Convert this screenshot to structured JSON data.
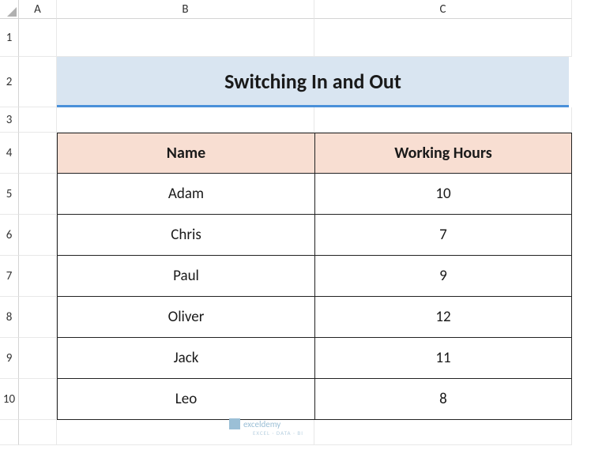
{
  "columns": [
    "A",
    "B",
    "C"
  ],
  "rows": [
    "1",
    "2",
    "3",
    "4",
    "5",
    "6",
    "7",
    "8",
    "9",
    "10"
  ],
  "title": "Switching In and Out",
  "table": {
    "headers": {
      "name": "Name",
      "hours": "Working Hours"
    },
    "rows": [
      {
        "name": "Adam",
        "hours": "10"
      },
      {
        "name": "Chris",
        "hours": "7"
      },
      {
        "name": "Paul",
        "hours": "9"
      },
      {
        "name": "Oliver",
        "hours": "12"
      },
      {
        "name": "Jack",
        "hours": "11"
      },
      {
        "name": "Leo",
        "hours": "8"
      }
    ]
  },
  "watermark": {
    "brand": "exceldemy",
    "tagline": "EXCEL · DATA · BI"
  },
  "chart_data": {
    "type": "table",
    "title": "Switching In and Out",
    "categories": [
      "Adam",
      "Chris",
      "Paul",
      "Oliver",
      "Jack",
      "Leo"
    ],
    "values": [
      10,
      7,
      9,
      12,
      11,
      8
    ],
    "xlabel": "Name",
    "ylabel": "Working Hours"
  }
}
